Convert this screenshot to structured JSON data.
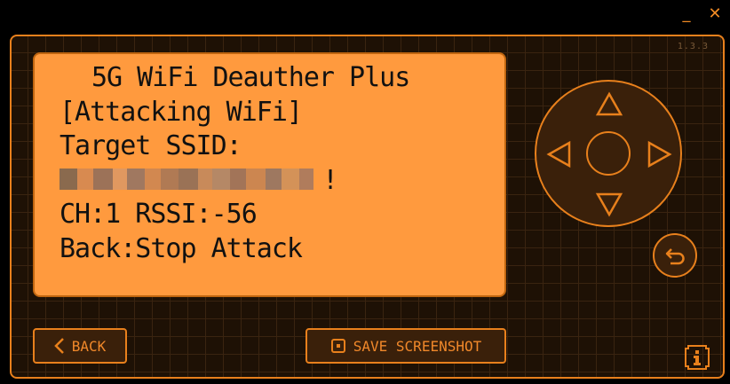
{
  "window": {
    "minimize_label": "_",
    "close_label": "✕"
  },
  "app": {
    "version": "1.3.3"
  },
  "screen": {
    "title": "5G WiFi Deauther Plus",
    "status": "[Attacking WiFi]",
    "target_label": "Target SSID:",
    "ssid_end": "!",
    "channel_rssi": "CH:1 RSSI:-56",
    "back_hint": "Back:Stop Attack"
  },
  "controls": {
    "back_label": "BACK",
    "screenshot_label": "SAVE SCREENSHOT"
  },
  "icons": {
    "dpad_up": "triangle-up-icon",
    "dpad_down": "triangle-down-icon",
    "dpad_left": "triangle-left-icon",
    "dpad_right": "triangle-right-icon",
    "return": "return-arrow-icon",
    "info": "info-icon",
    "screenshot": "screenshot-icon",
    "back": "chevron-left-icon"
  },
  "colors": {
    "accent": "#e8801c",
    "screen_bg": "#ff9a3e",
    "frame_bg": "#1e1105",
    "text_dark": "#111111"
  }
}
